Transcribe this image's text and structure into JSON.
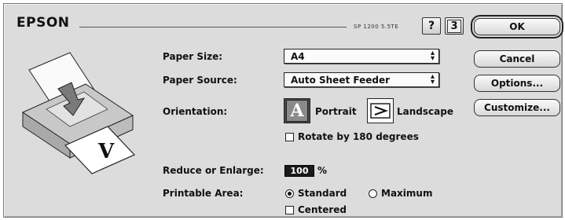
{
  "header": {
    "brand": "EPSON",
    "version": "SP 1200 5.5TE",
    "help_label": "?",
    "page_icon_label": "3"
  },
  "buttons": {
    "ok": "OK",
    "cancel": "Cancel",
    "options": "Options...",
    "customize": "Customize..."
  },
  "form": {
    "paper_size_label": "Paper Size:",
    "paper_size_value": "A4",
    "paper_source_label": "Paper Source:",
    "paper_source_value": "Auto Sheet Feeder",
    "orientation_label": "Orientation:",
    "portrait_label": "Portrait",
    "landscape_label": "Landscape",
    "portrait_glyph": "A",
    "rotate_label": "Rotate by 180 degrees",
    "rotate_checked": false,
    "reduce_label": "Reduce or Enlarge:",
    "reduce_value": "100",
    "percent_sign": "%",
    "printable_area_label": "Printable Area:",
    "standard_label": "Standard",
    "maximum_label": "Maximum",
    "printable_area_selected": "Standard",
    "centered_label": "Centered",
    "centered_checked": false
  },
  "illustration": {
    "page_glyph": "V"
  },
  "icons": {
    "popup_arrows": "popup-arrows-icon",
    "help": "help-icon",
    "page_setup": "page-setup-icon",
    "printer": "printer-illustration"
  }
}
